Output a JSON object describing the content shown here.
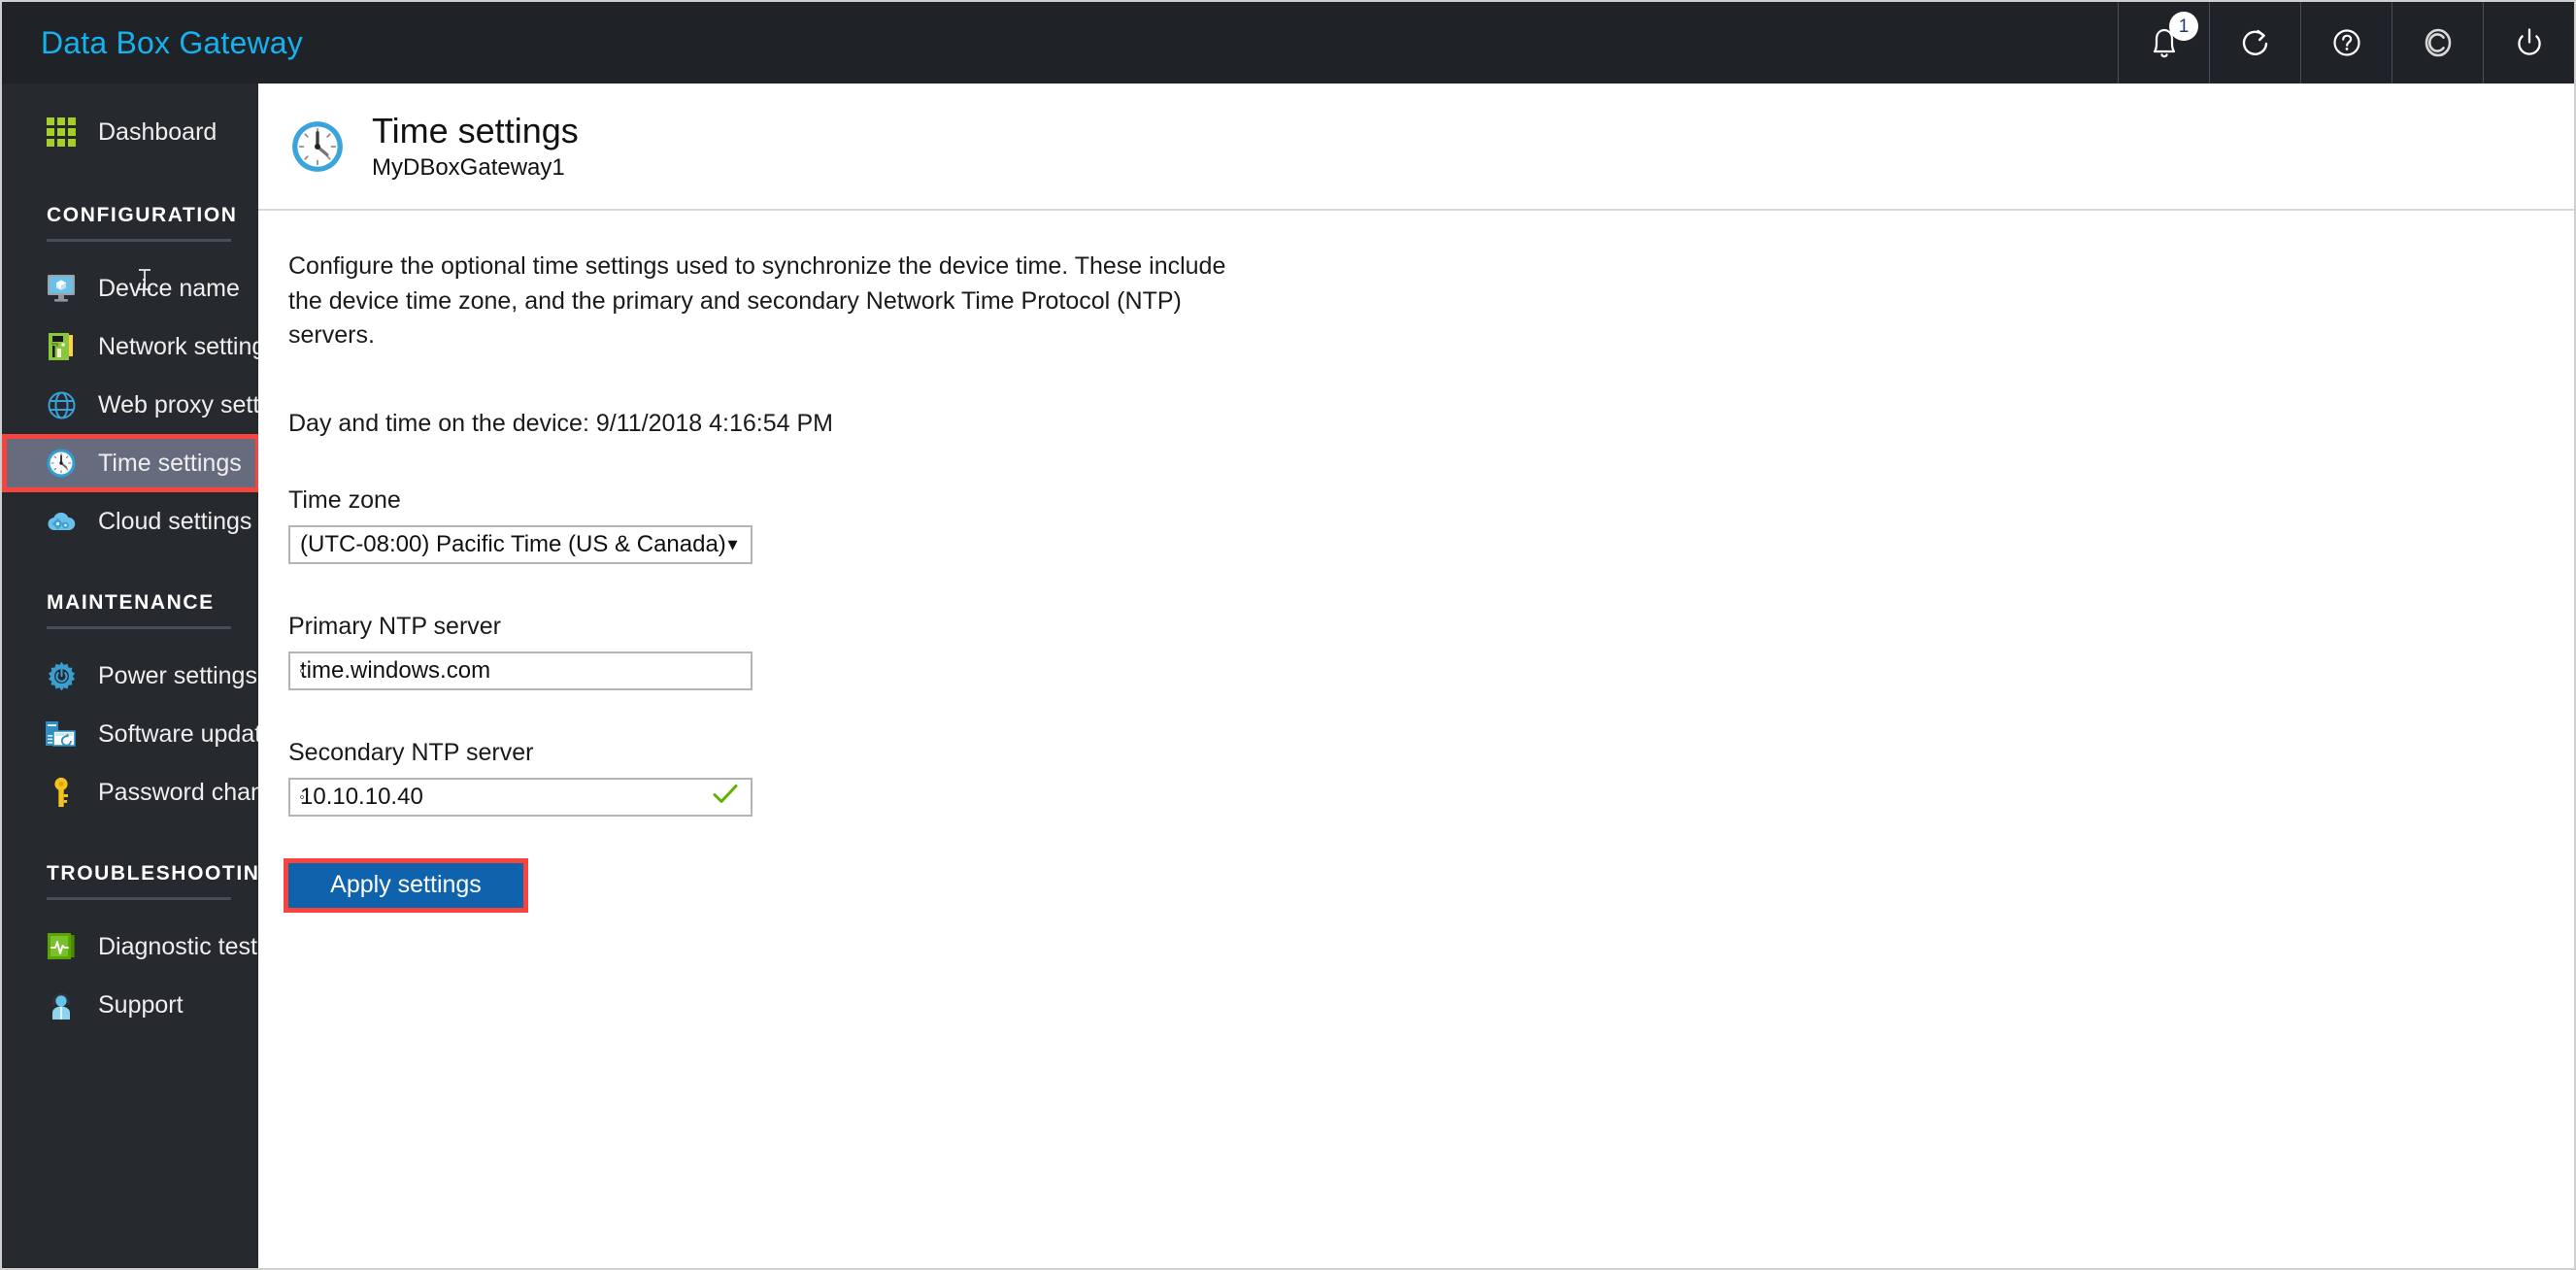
{
  "topbar": {
    "brand": "Data Box Gateway",
    "icons": [
      {
        "name": "notifications-icon",
        "badge": "1"
      },
      {
        "name": "refresh-icon",
        "badge": ""
      },
      {
        "name": "help-icon",
        "badge": ""
      },
      {
        "name": "copyright-icon",
        "badge": ""
      },
      {
        "name": "power-icon",
        "badge": ""
      }
    ]
  },
  "sidebar": {
    "dashboard": {
      "label": "Dashboard",
      "icon": "grid-icon"
    },
    "sections": [
      {
        "heading": "CONFIGURATION",
        "items": [
          {
            "label": "Device name",
            "icon": "monitor-icon",
            "selected": false
          },
          {
            "label": "Network settings",
            "icon": "network-card-icon",
            "selected": false
          },
          {
            "label": "Web proxy settings",
            "icon": "globe-icon",
            "selected": false
          },
          {
            "label": "Time settings",
            "icon": "clock-icon",
            "selected": true
          },
          {
            "label": "Cloud settings",
            "icon": "cloud-gears-icon",
            "selected": false
          }
        ]
      },
      {
        "heading": "MAINTENANCE",
        "items": [
          {
            "label": "Power settings",
            "icon": "gear-power-icon",
            "selected": false
          },
          {
            "label": "Software update",
            "icon": "software-update-icon",
            "selected": false
          },
          {
            "label": "Password change",
            "icon": "key-icon",
            "selected": false
          }
        ]
      },
      {
        "heading": "TROUBLESHOOTING",
        "items": [
          {
            "label": "Diagnostic tests",
            "icon": "diagnostics-icon",
            "selected": false
          },
          {
            "label": "Support",
            "icon": "support-person-icon",
            "selected": false
          }
        ]
      }
    ]
  },
  "page": {
    "icon": "clock-icon",
    "title": "Time settings",
    "subtitle": "MyDBoxGateway1",
    "intro": "Configure the optional time settings used to synchronize the device time. These include the device time zone, and the primary and secondary Network Time Protocol (NTP) servers.",
    "device_time": "Day and time on the device: 9/11/2018 4:16:54 PM",
    "fields": {
      "timezone": {
        "label": "Time zone",
        "value": "(UTC-08:00) Pacific Time (US & Canada)",
        "caret": "▼"
      },
      "primary_ntp": {
        "label": "Primary NTP server",
        "value": "time.windows.com",
        "placeholder": "Primary NTP server"
      },
      "secondary_ntp": {
        "label": "Secondary NTP server",
        "value": "10.10.10.40",
        "placeholder": "Secondary NTP server",
        "validation_icon": "checkmark-icon"
      }
    },
    "apply_button": "Apply settings"
  },
  "colors": {
    "brand_accent": "#15b2f0",
    "topbar_bg": "#1f2226",
    "sidebar_bg": "#26292d",
    "nav_selected_bg": "#666b7e",
    "annotation_red": "#f8443f",
    "primary_button": "#0f62ac",
    "validation_green": "#5cb300"
  }
}
